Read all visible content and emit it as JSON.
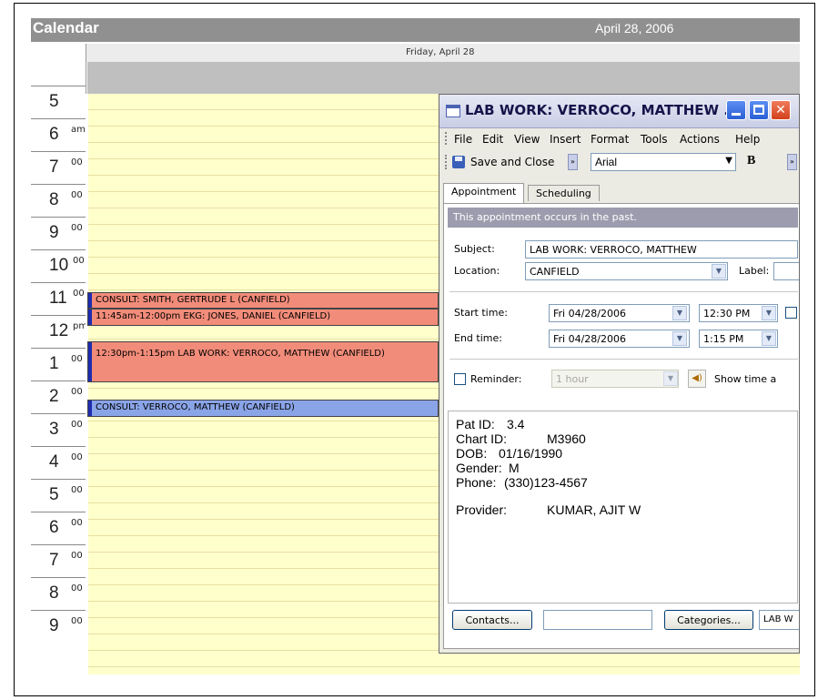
{
  "calendar": {
    "title": "Calendar",
    "date": "April 28, 2006",
    "day_header": "Friday, April 28"
  },
  "hours": [
    {
      "num": "5",
      "sup": ""
    },
    {
      "num": "6",
      "sup": "am"
    },
    {
      "num": "7",
      "sup": "00"
    },
    {
      "num": "8",
      "sup": "00"
    },
    {
      "num": "9",
      "sup": "00"
    },
    {
      "num": "10",
      "sup": "00"
    },
    {
      "num": "11",
      "sup": "00"
    },
    {
      "num": "12",
      "sup": "pm"
    },
    {
      "num": "1",
      "sup": "00"
    },
    {
      "num": "2",
      "sup": "00"
    },
    {
      "num": "3",
      "sup": "00"
    },
    {
      "num": "4",
      "sup": "00"
    },
    {
      "num": "5",
      "sup": "00"
    },
    {
      "num": "6",
      "sup": "00"
    },
    {
      "num": "7",
      "sup": "00"
    },
    {
      "num": "8",
      "sup": "00"
    },
    {
      "num": "9",
      "sup": "00"
    }
  ],
  "appointments": [
    {
      "text": "CONSULT: SMITH, GERTRUDE L (CANFIELD)",
      "color": "#f28c7a"
    },
    {
      "text": "11:45am-12:00pm EKG: JONES, DANIEL  (CANFIELD)",
      "color": "#f28c7a"
    },
    {
      "text": "12:30pm-1:15pm LAB WORK: VERROCO, MATTHEW  (CANFIELD)",
      "color": "#f28c7a"
    },
    {
      "text": "CONSULT: VERROCO, MATTHEW  (CANFIELD)",
      "color": "#8aa4e8"
    }
  ],
  "dialog": {
    "title": "LAB WORK: VERROCO, MATTHEW ...",
    "menu": [
      "File",
      "Edit",
      "View",
      "Insert",
      "Format",
      "Tools",
      "Actions",
      "Help"
    ],
    "toolbar": {
      "save_close": "Save and Close",
      "font": "Arial",
      "bold": "B"
    },
    "tabs": [
      "Appointment",
      "Scheduling"
    ],
    "info_bar": "This appointment occurs in the past.",
    "subject_label": "Subject:",
    "subject_value": "LAB WORK: VERROCO, MATTHEW",
    "location_label": "Location:",
    "location_value": "CANFIELD",
    "label_label": "Label:",
    "start_label": "Start time:",
    "start_date": "Fri 04/28/2006",
    "start_time": "12:30 PM",
    "end_label": "End time:",
    "end_date": "Fri 04/28/2006",
    "end_time": "1:15 PM",
    "reminder_label": "Reminder:",
    "reminder_value": "1 hour",
    "show_time_as": "Show time a",
    "notes": {
      "pat_id_label": "Pat ID:",
      "pat_id": "3.4",
      "chart_id_label": "Chart ID:",
      "chart_id": "M3960",
      "dob_label": "DOB:",
      "dob": "01/16/1990",
      "gender_label": "Gender:",
      "gender": "M",
      "phone_label": "Phone:",
      "phone": "(330)123-4567",
      "provider_label": "Provider:",
      "provider": "KUMAR, AJIT W"
    },
    "contacts_button": "Contacts...",
    "categories_button": "Categories...",
    "categories_value": "LAB W"
  }
}
